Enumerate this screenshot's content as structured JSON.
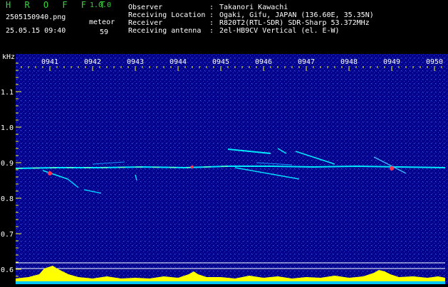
{
  "app": {
    "name": "H R O F F T",
    "version": "1.0.0",
    "filename": "2505150940.png",
    "datetime": "25.05.15 09:40",
    "meteor_label": "meteor",
    "meteor_count": "59"
  },
  "info": [
    {
      "label": "Observer",
      "sep": ":",
      "value": "Takanori Kawachi"
    },
    {
      "label": "Receiving Location",
      "sep": ":",
      "value": "Ogaki, Gifu, JAPAN (136.60E, 35.35N)"
    },
    {
      "label": "Receiver",
      "sep": ":",
      "value": "R820T2(RTL-SDR) SDR-Sharp 53.372MHz"
    },
    {
      "label": "Receiving antenna",
      "sep": ":",
      "value": "2el-HB9CV Vertical (el. E-W)"
    }
  ],
  "colors": {
    "background": "#000000",
    "plot_background": "#00008c",
    "title_green": "#36d83a",
    "axis_yellow": "#ffff00",
    "carrier_cyan": "#00ffff",
    "echo_red": "#ff3050",
    "ionosphere_fill": "#ffff00"
  },
  "spectrogram": {
    "unit_label": "kHz",
    "time_labels": [
      "0941",
      "0942",
      "0943",
      "0944",
      "0945",
      "0946",
      "0947",
      "0948",
      "0949",
      "0950"
    ],
    "freq_labels": [
      "1.1",
      "1.0",
      "0.9",
      "0.8",
      "0.7",
      "0.6"
    ]
  }
}
